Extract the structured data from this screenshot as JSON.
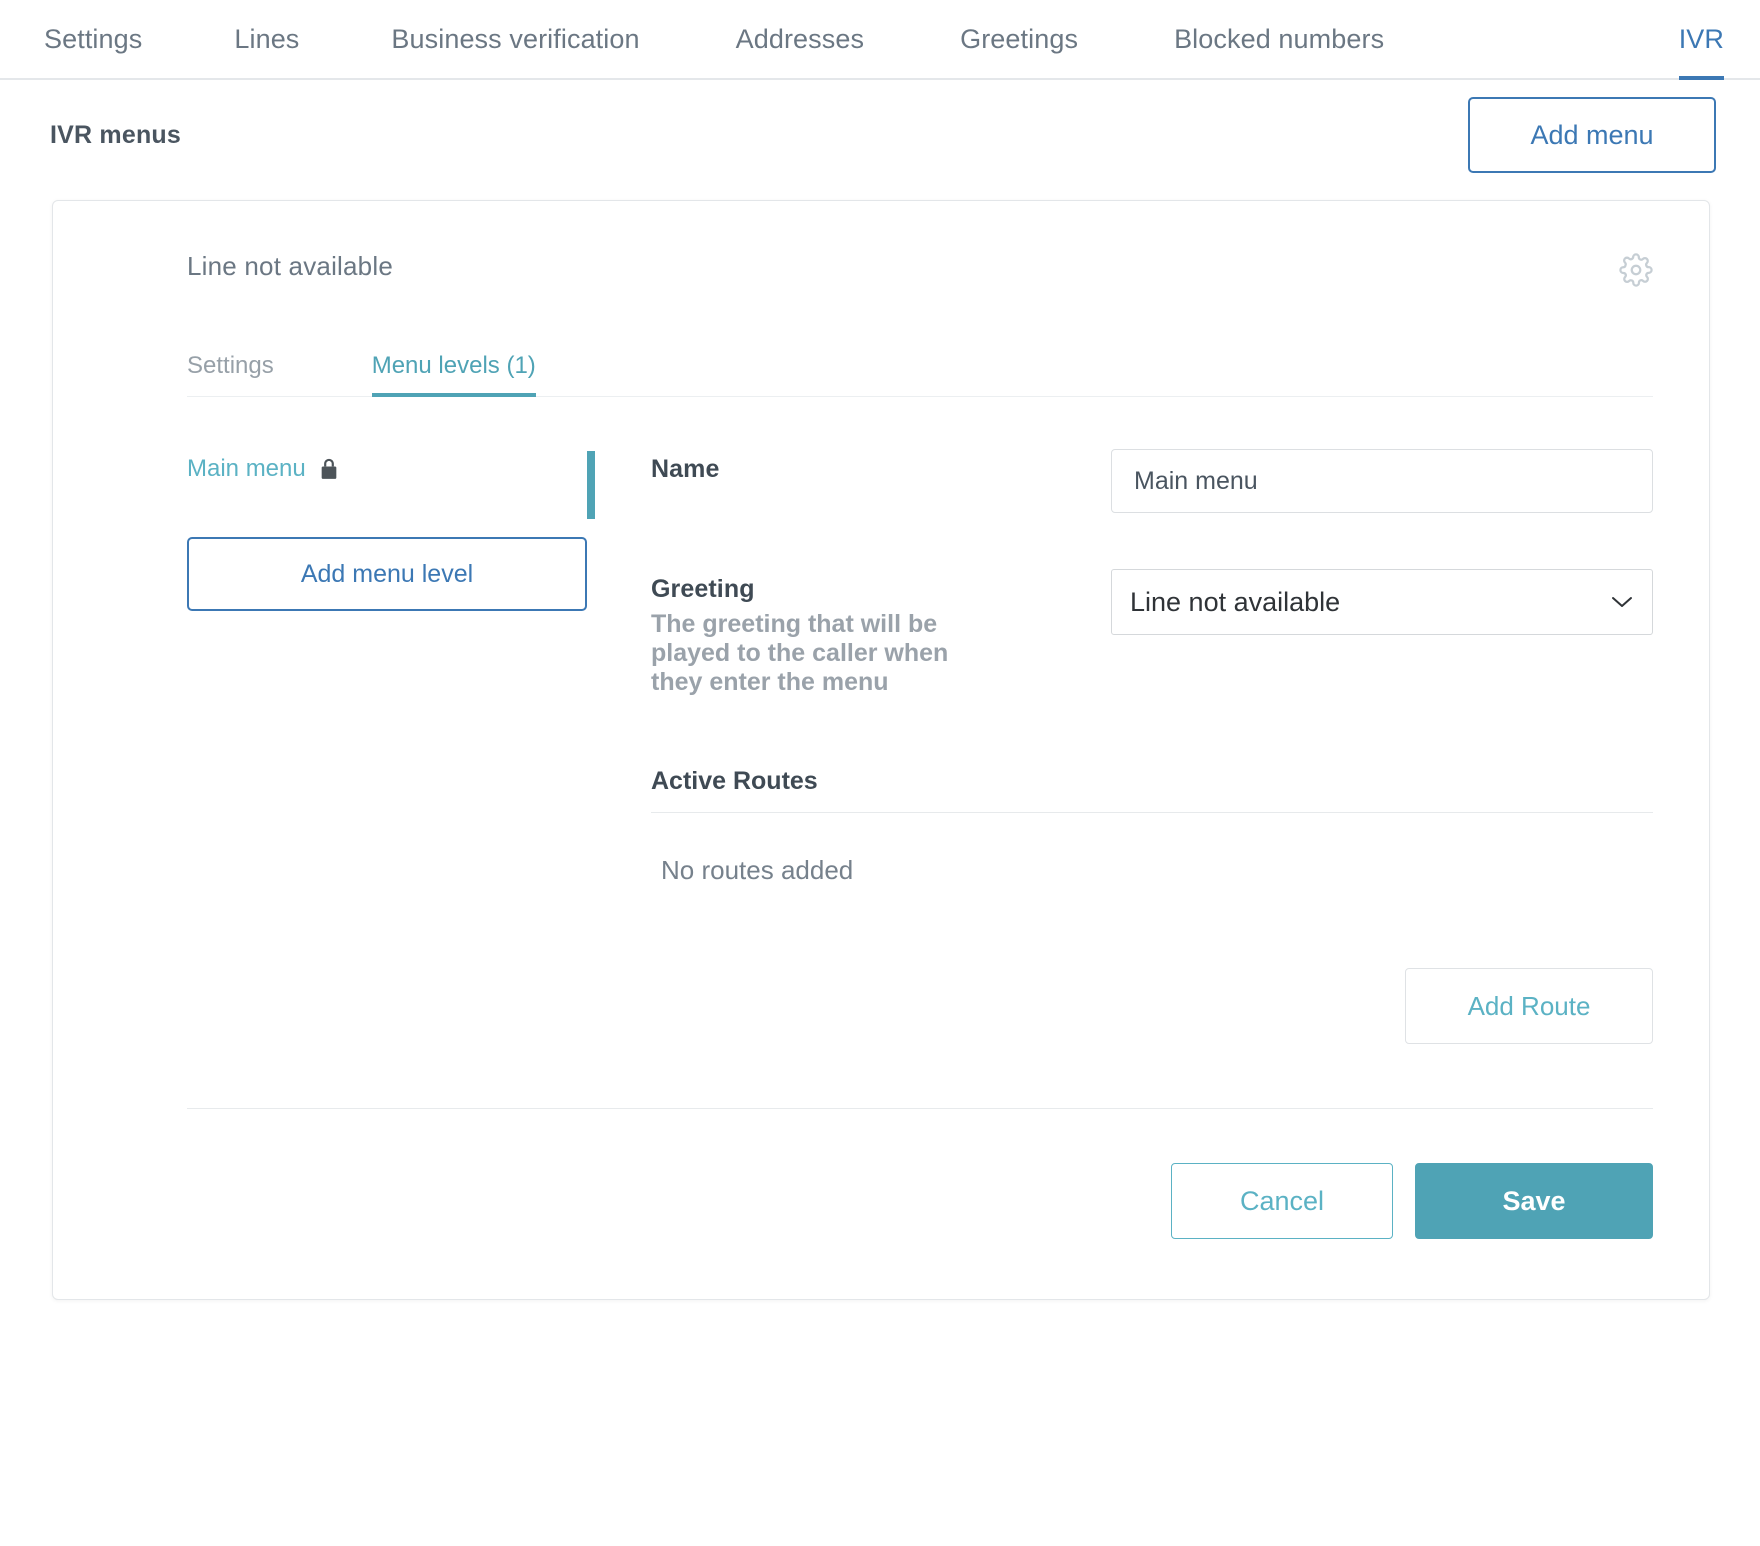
{
  "topnav": {
    "tabs": [
      {
        "label": "Settings",
        "active": false
      },
      {
        "label": "Lines",
        "active": false
      },
      {
        "label": "Business verification",
        "active": false
      },
      {
        "label": "Addresses",
        "active": false
      },
      {
        "label": "Greetings",
        "active": false
      },
      {
        "label": "Blocked numbers",
        "active": false
      },
      {
        "label": "IVR",
        "active": true
      }
    ],
    "active_color": "#3c78b4",
    "inactive_color": "#6b7783"
  },
  "page_header": {
    "title": "IVR menus",
    "add_menu_label": "Add menu"
  },
  "card": {
    "title": "Line not available",
    "settings_icon": "gear-icon",
    "tabs": [
      {
        "label": "Settings",
        "active": false
      },
      {
        "label": "Menu levels (1)",
        "active": true
      }
    ],
    "accent_color": "#4fa3b5",
    "menu_levels": {
      "items": [
        {
          "label": "Main menu",
          "icon": "lock-icon",
          "locked": true
        }
      ],
      "add_level_label": "Add menu level"
    },
    "form": {
      "name": {
        "label": "Name",
        "value": "Main menu",
        "placeholder": "Main menu"
      },
      "greeting": {
        "label": "Greeting",
        "help": "The greeting that will be played to the caller when they enter the menu",
        "value": "Line not available",
        "options": [
          "Line not available"
        ]
      }
    },
    "active_routes": {
      "title": "Active Routes",
      "empty_text": "No routes added",
      "add_route_label": "Add Route"
    },
    "footer": {
      "cancel_label": "Cancel",
      "save_label": "Save"
    }
  }
}
